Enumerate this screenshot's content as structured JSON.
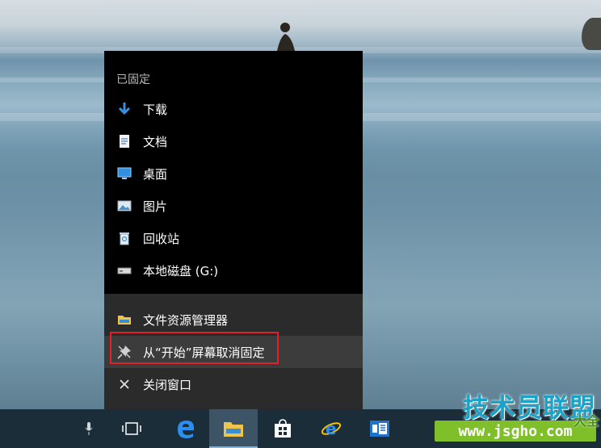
{
  "jumplist": {
    "section_header": "已固定",
    "pinned": [
      {
        "label": "下载",
        "icon": "download-arrow-icon"
      },
      {
        "label": "文档",
        "icon": "document-icon"
      },
      {
        "label": "桌面",
        "icon": "desktop-icon"
      },
      {
        "label": "图片",
        "icon": "pictures-icon"
      },
      {
        "label": "回收站",
        "icon": "recycle-bin-icon"
      },
      {
        "label": "本地磁盘 (G:)",
        "icon": "drive-icon"
      }
    ],
    "tasks": [
      {
        "label": "文件资源管理器",
        "icon": "file-explorer-icon"
      },
      {
        "label": "从“开始”屏幕取消固定",
        "icon": "unpin-icon"
      },
      {
        "label": "关闭窗口",
        "icon": "close-icon"
      }
    ]
  },
  "taskbar": {
    "buttons": [
      "task-view-icon",
      "edge-icon",
      "file-explorer-icon",
      "store-icon",
      "internet-explorer-icon",
      "outlook-calendar-icon"
    ]
  },
  "watermark": {
    "title": "技术员联盟",
    "url": "www.jsgho.com",
    "extra": "大全"
  },
  "colors": {
    "highlight_border": "#e0212a",
    "watermark_blue": "#1aa3c8",
    "watermark_green": "#7fbf2a"
  }
}
